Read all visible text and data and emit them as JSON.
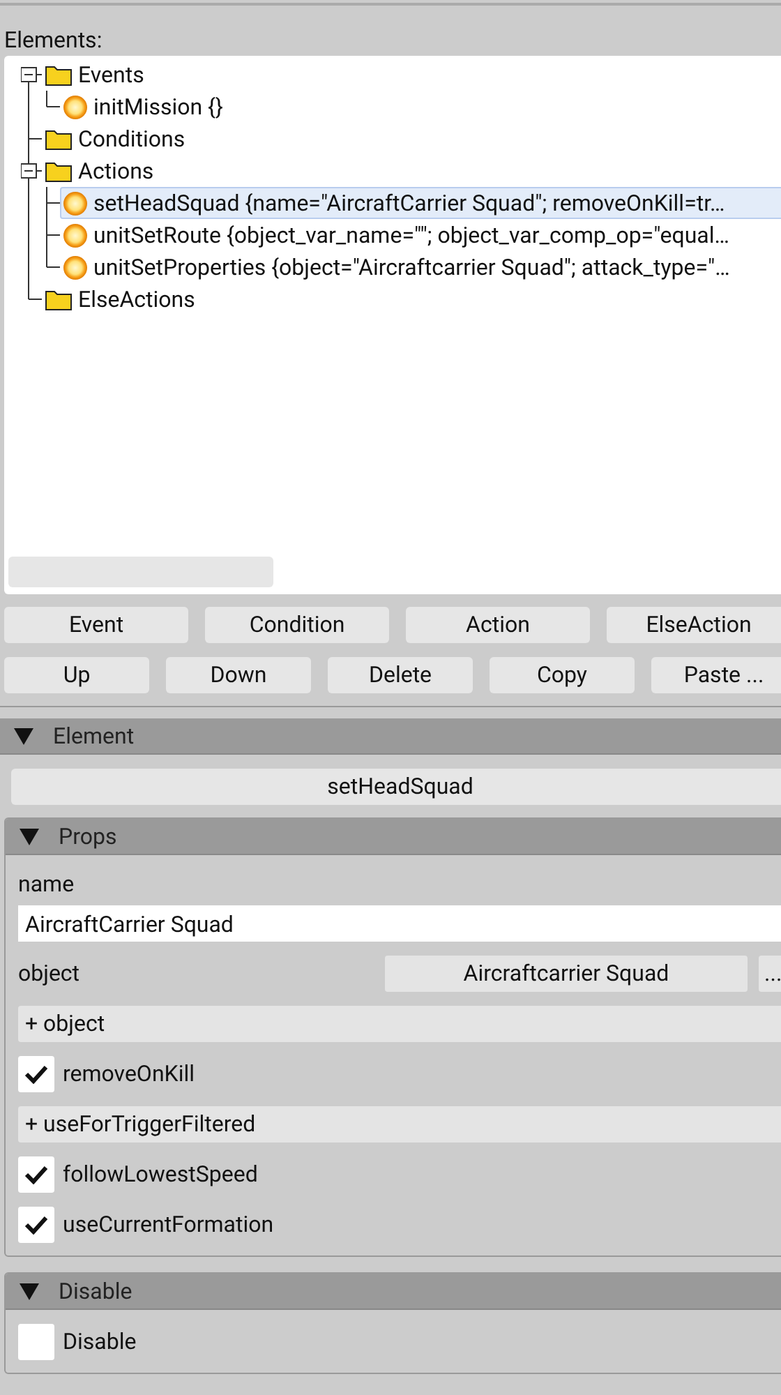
{
  "section_label": "Elements:",
  "tree": [
    {
      "label": "Events",
      "kind": "folder",
      "selected": false,
      "expanded": true,
      "children": [
        {
          "label": "initMission {}",
          "kind": "action",
          "selected": false
        }
      ]
    },
    {
      "label": "Conditions",
      "kind": "folder",
      "selected": false
    },
    {
      "label": "Actions",
      "kind": "folder",
      "selected": false,
      "expanded": true,
      "children": [
        {
          "label": "setHeadSquad {name=\"AircraftCarrier Squad\"; removeOnKill=tr…",
          "kind": "action",
          "selected": true
        },
        {
          "label": "unitSetRoute {object_var_name=\"\"; object_var_comp_op=\"equal…",
          "kind": "action",
          "selected": false
        },
        {
          "label": "unitSetProperties {object=\"Aircraftcarrier Squad\"; attack_type=\"…",
          "kind": "action",
          "selected": false
        }
      ]
    },
    {
      "label": "ElseActions",
      "kind": "folder",
      "selected": false
    }
  ],
  "button_rows": [
    [
      "Event",
      "Condition",
      "Action",
      "ElseAction"
    ],
    [
      "Up",
      "Down",
      "Delete",
      "Copy",
      "Paste ..."
    ]
  ],
  "element": {
    "title": "Element",
    "expanded": true,
    "name_button": "setHeadSquad",
    "groups": [
      {
        "title": "Props",
        "expanded": true,
        "fields": [
          {
            "kind": "text",
            "label": "name",
            "value": "AircraftCarrier Squad"
          },
          {
            "kind": "picker",
            "label": "object",
            "value": "Aircraftcarrier Squad",
            "more": "..."
          },
          {
            "kind": "add",
            "label": "+ object"
          },
          {
            "kind": "checkbox",
            "label": "removeOnKill",
            "checked": true
          },
          {
            "kind": "add",
            "label": "+ useForTriggerFiltered"
          },
          {
            "kind": "checkbox",
            "label": "followLowestSpeed",
            "checked": true
          },
          {
            "kind": "checkbox",
            "label": "useCurrentFormation",
            "checked": true
          }
        ]
      },
      {
        "title": "Disable",
        "expanded": true,
        "fields": [
          {
            "kind": "checkbox",
            "label": "Disable",
            "checked": false
          }
        ]
      }
    ]
  }
}
